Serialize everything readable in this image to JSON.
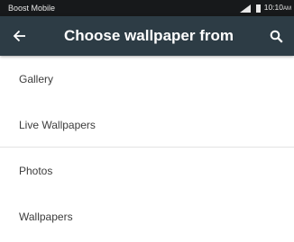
{
  "status_bar": {
    "carrier": "Boost Mobile",
    "time": "10:10",
    "time_suffix": "AM",
    "icons": [
      "signal-icon",
      "battery-icon"
    ]
  },
  "toolbar": {
    "title": "Choose wallpaper from",
    "back_icon": "back-arrow-icon",
    "search_icon": "search-icon",
    "background": "#2d3c45"
  },
  "list": {
    "items": [
      {
        "label": "Gallery"
      },
      {
        "label": "Live Wallpapers"
      },
      {
        "label": "Photos"
      },
      {
        "label": "Wallpapers"
      }
    ]
  }
}
